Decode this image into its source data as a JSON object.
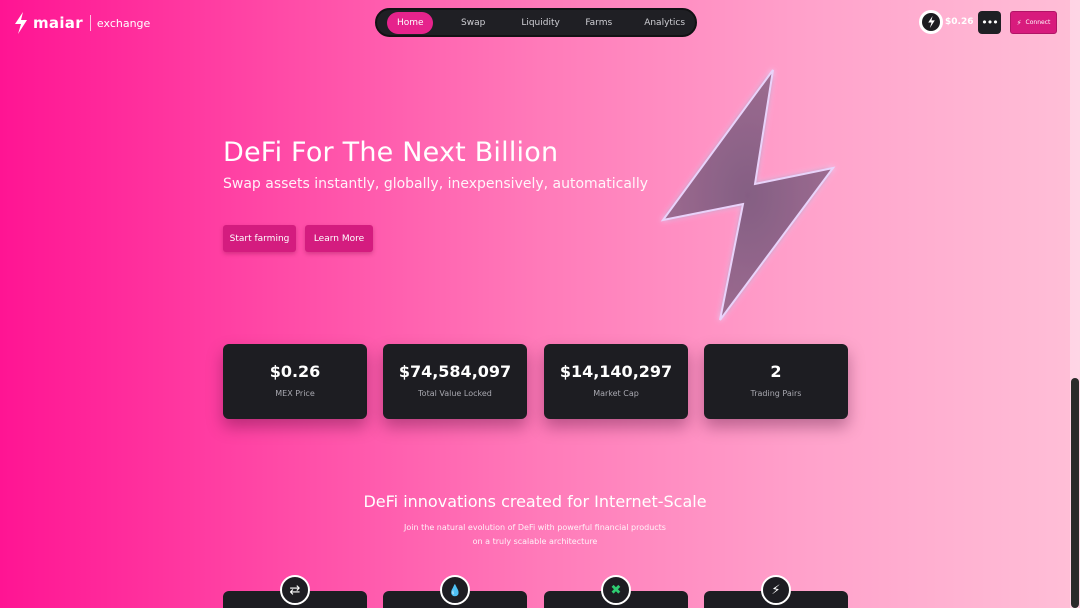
{
  "header": {
    "brand": "maiar",
    "sub": "exchange",
    "nav": [
      "Home",
      "Swap",
      "Liquidity",
      "Farms",
      "Analytics"
    ],
    "price": "$0.26",
    "more": "•••",
    "connect": "Connect"
  },
  "hero": {
    "title": "DeFi For The Next Billion",
    "subtitle": "Swap assets instantly, globally, inexpensively, automatically",
    "btn_farm": "Start farming",
    "btn_learn": "Learn More"
  },
  "stats": [
    {
      "value": "$0.26",
      "label": "MEX Price"
    },
    {
      "value": "$74,584,097",
      "label": "Total Value Locked"
    },
    {
      "value": "$14,140,297",
      "label": "Market Cap"
    },
    {
      "value": "2",
      "label": "Trading Pairs"
    }
  ],
  "section": {
    "title": "DeFi innovations created for Internet-Scale",
    "sub1": "Join the natural evolution of DeFi with powerful financial products",
    "sub2": "on a truly scalable architecture"
  },
  "feature_icons": {
    "swap": "⇄",
    "drop": "💧",
    "tools": "✖",
    "bolt": "⚡"
  },
  "colors": {
    "accent": "#e6238c",
    "dark_card": "#1d1d22",
    "bg_left": "#ff1493",
    "bg_right": "#ffbfd7"
  }
}
